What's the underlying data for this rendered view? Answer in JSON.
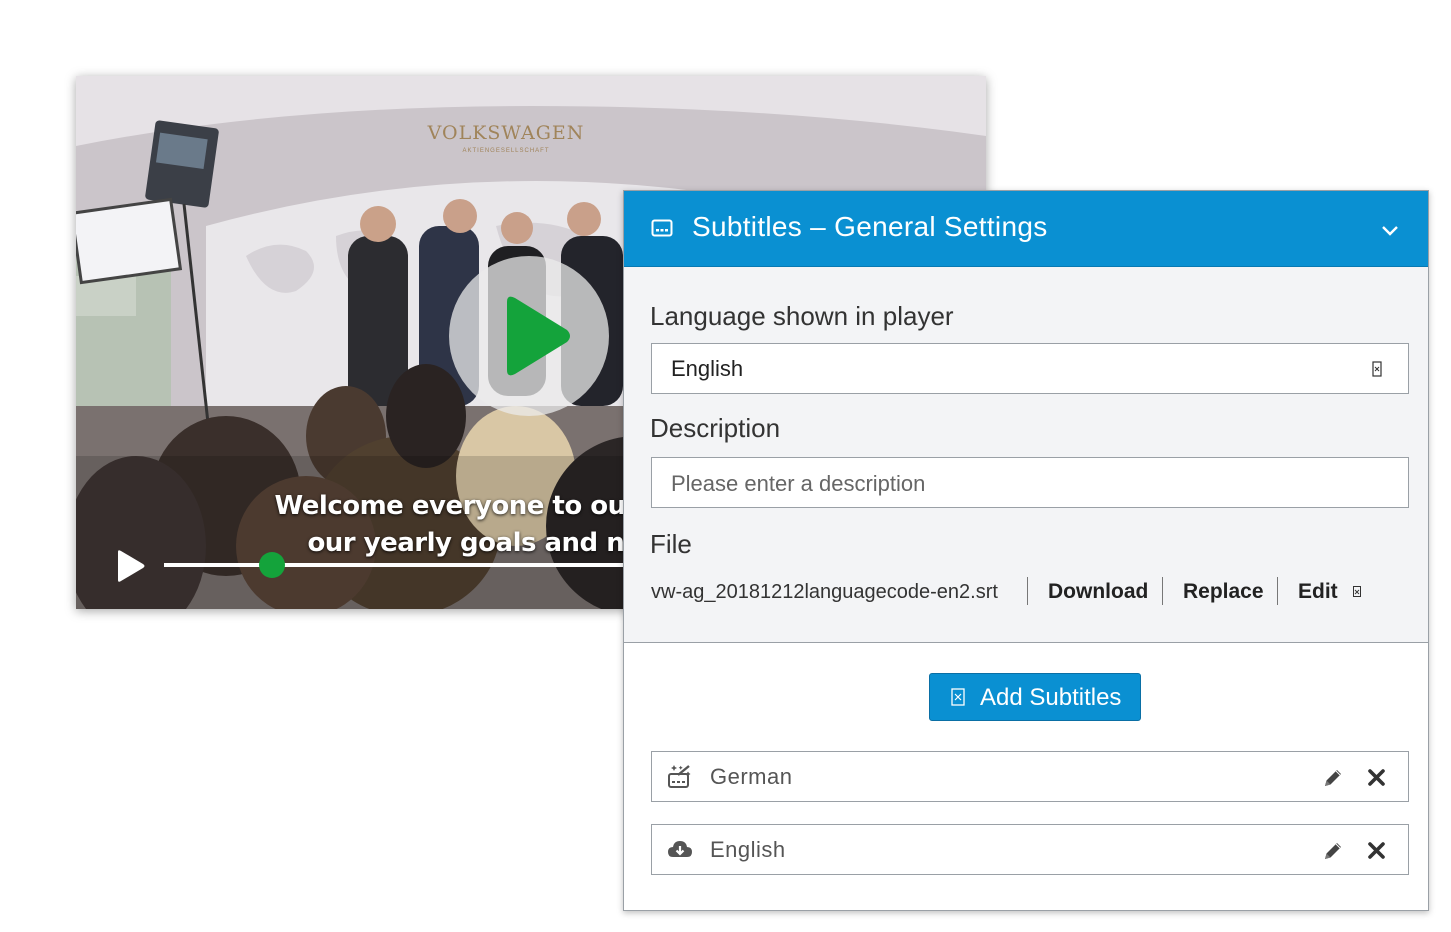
{
  "video": {
    "brand": "VOLKSWAGEN",
    "brand_sub": "AKTIENGESELLSCHAFT",
    "caption_line1": "Welcome everyone to our TownHa",
    "caption_line2": "our yearly goals and new bus",
    "progress": 0.23,
    "accent_color": "#14a33b"
  },
  "panel": {
    "header_icon": "subtitles-icon",
    "title": "Subtitles – General Settings",
    "language_label": "Language shown in player",
    "language_value": "English",
    "description_label": "Description",
    "description_placeholder": "Please enter a description",
    "file_label": "File",
    "file_name": "vw-ag_20181212languagecode-en2.srt",
    "file_actions": {
      "download": "Download",
      "replace": "Replace",
      "edit": "Edit"
    },
    "add_button": "Add Subtitles",
    "subtitles": [
      {
        "icon": "auto-generate-icon",
        "label": "German"
      },
      {
        "icon": "cloud-download-icon",
        "label": "English"
      }
    ],
    "header_color": "#0a90d2"
  }
}
